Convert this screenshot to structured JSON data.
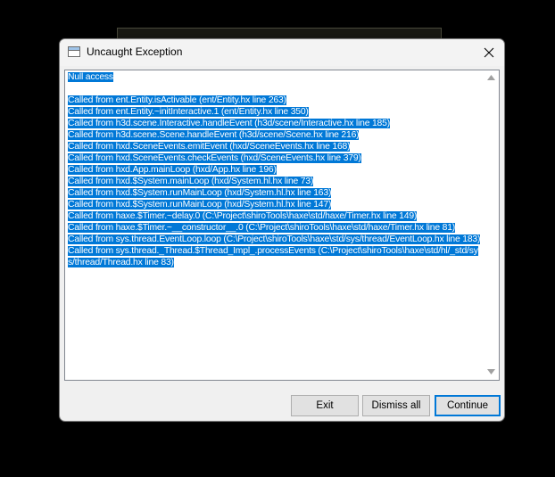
{
  "window": {
    "title": "Uncaught Exception"
  },
  "icons": {
    "app": "application-window-icon",
    "close": "close-x-icon",
    "scroll_up": "triangle-up-icon",
    "scroll_down": "triangle-down-icon"
  },
  "colors": {
    "selection": "#0078d7",
    "default_button_border": "#0078d7",
    "dialog_background": "#f0f0f0"
  },
  "error": {
    "message": "Null access",
    "stack": [
      "Called from ent.Entity.isActivable (ent/Entity.hx line 263)",
      "Called from ent.Entity.~initInteractive.1 (ent/Entity.hx line 350)",
      "Called from h3d.scene.Interactive.handleEvent (h3d/scene/Interactive.hx line 185)",
      "Called from h3d.scene.Scene.handleEvent (h3d/scene/Scene.hx line 216)",
      "Called from hxd.SceneEvents.emitEvent (hxd/SceneEvents.hx line 168)",
      "Called from hxd.SceneEvents.checkEvents (hxd/SceneEvents.hx line 379)",
      "Called from hxd.App.mainLoop (hxd/App.hx line 196)",
      "Called from hxd.$System.mainLoop (hxd/System.hl.hx line 73)",
      "Called from hxd.$System.runMainLoop (hxd/System.hl.hx line 163)",
      "Called from hxd.$System.runMainLoop (hxd/System.hl.hx line 147)",
      "Called from haxe.$Timer.~delay.0 (C:\\Project\\shiroTools\\haxe\\std/haxe/Timer.hx line 149)",
      "Called from haxe.$Timer.~__constructor__.0 (C:\\Project\\shiroTools\\haxe\\std/haxe/Timer.hx line 81)",
      "Called from sys.thread.EventLoop.loop (C:\\Project\\shiroTools\\haxe\\std/sys/thread/EventLoop.hx line 183)",
      "Called from sys.thread._Thread.$Thread_Impl_.processEvents (C:\\Project\\shiroTools\\haxe\\std/hl/_std/sys/thread/Thread.hx line 83)"
    ]
  },
  "buttons": {
    "exit": "Exit",
    "dismiss_all": "Dismiss all",
    "continue": "Continue"
  }
}
